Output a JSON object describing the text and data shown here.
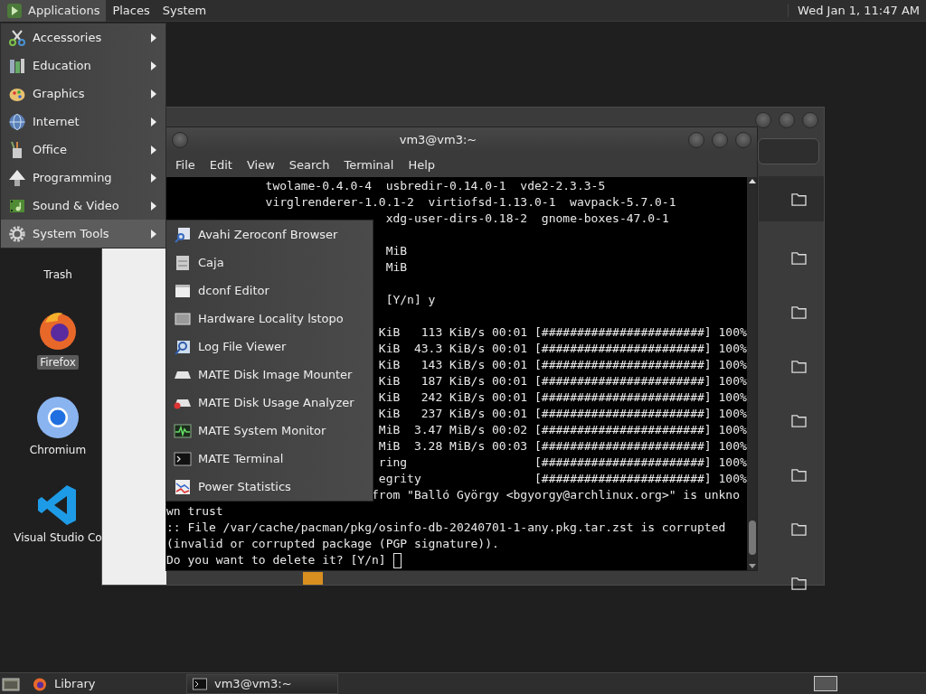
{
  "top_panel": {
    "menus": [
      {
        "label": "Applications",
        "selected": true
      },
      {
        "label": "Places",
        "selected": false
      },
      {
        "label": "System",
        "selected": false
      }
    ],
    "clock": "Wed Jan 1, 11:47 AM"
  },
  "desktop_icons": [
    {
      "label": "Trash",
      "kind": "trash",
      "selected": false
    },
    {
      "label": "Firefox",
      "kind": "firefox",
      "selected": true
    },
    {
      "label": "Chromium",
      "kind": "chromium",
      "selected": false
    },
    {
      "label": "Visual Studio Co",
      "kind": "vscode",
      "selected": false
    }
  ],
  "terminal": {
    "title": "vm3@vm3:~",
    "menus": [
      "File",
      "Edit",
      "View",
      "Search",
      "Terminal",
      "Help"
    ],
    "lines": [
      {
        "kind": "text",
        "text": "              twolame-0.4.0-4  usbredir-0.14.0-1  vde2-2.3.3-5"
      },
      {
        "kind": "text",
        "text": "              virglrenderer-1.0.1-2  virtiofsd-1.13.0-1  wavpack-5.7.0-1"
      },
      {
        "kind": "text",
        "text": "                               xdg-user-dirs-0.18-2  gnome-boxes-47.0-1"
      },
      {
        "kind": "blank"
      },
      {
        "kind": "text",
        "text": "                               MiB"
      },
      {
        "kind": "text",
        "text": "                               MiB"
      },
      {
        "kind": "blank"
      },
      {
        "kind": "text",
        "text": "                               [Y/n] y"
      },
      {
        "kind": "blank"
      },
      {
        "kind": "text",
        "text": "                              KiB   113 KiB/s 00:01 [#######################] 100%"
      },
      {
        "kind": "text",
        "text": "                              KiB  43.3 KiB/s 00:01 [#######################] 100%"
      },
      {
        "kind": "text",
        "text": "                              KiB   143 KiB/s 00:01 [#######################] 100%"
      },
      {
        "kind": "text",
        "text": "                              KiB   187 KiB/s 00:01 [#######################] 100%"
      },
      {
        "kind": "text",
        "text": "                              KiB   242 KiB/s 00:01 [#######################] 100%"
      },
      {
        "kind": "text",
        "text": "                              KiB   237 KiB/s 00:01 [#######################] 100%"
      },
      {
        "kind": "text",
        "text": "                              MiB  3.47 MiB/s 00:02 [#######################] 100%"
      },
      {
        "kind": "text",
        "text": "                              MiB  3.28 MiB/s 00:03 [#######################] 100%"
      },
      {
        "kind": "text",
        "text": "                              ring                  [#######################] 100%"
      },
      {
        "kind": "text",
        "text": "                              egrity                [#######################] 100%"
      },
      {
        "kind": "text",
        "text": "                             from \"Balló György <bgyorgy@archlinux.org>\" is unkno"
      },
      {
        "kind": "text",
        "text": "wn trust"
      },
      {
        "kind": "text",
        "text": ":: File /var/cache/pacman/pkg/osinfo-db-20240701-1-any.pkg.tar.zst is corrupted"
      },
      {
        "kind": "text",
        "text": "(invalid or corrupted package (PGP signature))."
      },
      {
        "kind": "prompt",
        "text": "Do you want to delete it? [Y/n]"
      }
    ]
  },
  "applications_menu": {
    "items": [
      {
        "label": "Accessories",
        "kind": "accessories",
        "selected": false
      },
      {
        "label": "Education",
        "kind": "education",
        "selected": false
      },
      {
        "label": "Graphics",
        "kind": "graphics",
        "selected": false
      },
      {
        "label": "Internet",
        "kind": "internet",
        "selected": false
      },
      {
        "label": "Office",
        "kind": "office",
        "selected": false
      },
      {
        "label": "Programming",
        "kind": "programming",
        "selected": false
      },
      {
        "label": "Sound & Video",
        "kind": "sound-video",
        "selected": false
      },
      {
        "label": "System Tools",
        "kind": "system-tools",
        "selected": true
      }
    ]
  },
  "submenu": {
    "items": [
      {
        "label": "Avahi Zeroconf Browser",
        "kind": "avahi",
        "selected": false
      },
      {
        "label": "Caja",
        "kind": "caja",
        "selected": false
      },
      {
        "label": "dconf Editor",
        "kind": "dconf",
        "selected": false
      },
      {
        "label": "Hardware Locality lstopo",
        "kind": "hwloc",
        "selected": false
      },
      {
        "label": "Log File Viewer",
        "kind": "logviewer",
        "selected": false
      },
      {
        "label": "MATE Disk Image Mounter",
        "kind": "mounter",
        "selected": false
      },
      {
        "label": "MATE Disk Usage Analyzer",
        "kind": "usage",
        "selected": false
      },
      {
        "label": "MATE System Monitor",
        "kind": "monitor",
        "selected": false
      },
      {
        "label": "MATE Terminal",
        "kind": "terminal",
        "selected": false
      },
      {
        "label": "Power Statistics",
        "kind": "power",
        "selected": false
      }
    ]
  },
  "taskbar": {
    "tasks": [
      {
        "label": "Library",
        "kind": "firefox",
        "selected": false
      },
      {
        "label": "vm3@vm3:~",
        "kind": "terminal",
        "selected": true
      }
    ]
  }
}
